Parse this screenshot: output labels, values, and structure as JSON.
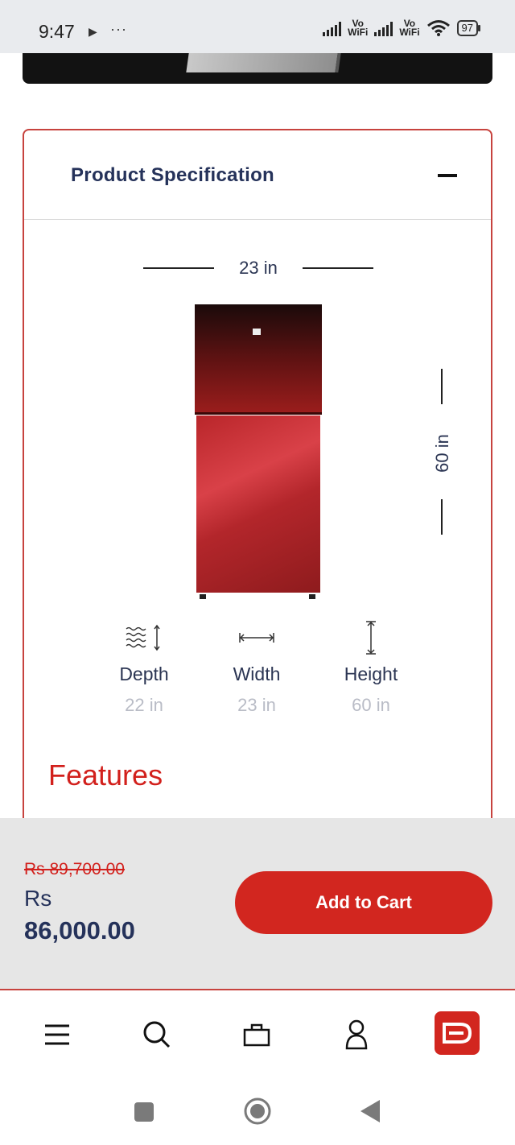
{
  "status_bar": {
    "time": "9:47",
    "play_icon": "play-icon",
    "dots": "···",
    "vowifi_1_top": "Vo",
    "vowifi_1_bottom": "WiFi",
    "vowifi_2_top": "Vo",
    "vowifi_2_bottom": "WiFi",
    "battery": "97"
  },
  "spec": {
    "title": "Product Specification",
    "collapse_icon": "minus-icon",
    "width_top": "23 in",
    "height_side": "60 in",
    "dimensions": [
      {
        "label": "Depth",
        "value": "22 in",
        "icon": "depth-icon"
      },
      {
        "label": "Width",
        "value": "23 in",
        "icon": "width-icon"
      },
      {
        "label": "Height",
        "value": "60 in",
        "icon": "height-icon"
      }
    ],
    "features_title": "Features"
  },
  "cart": {
    "old_price": "Rs 89,700.00",
    "price_currency": "Rs",
    "price_value": "86,000.00",
    "add_to_cart": "Add to Cart"
  },
  "bottom_nav": {
    "items": [
      "menu-icon",
      "search-icon",
      "bag-icon",
      "user-icon",
      "brand-logo-icon"
    ]
  },
  "system_nav": {
    "items": [
      "recents-icon",
      "home-icon",
      "back-icon"
    ]
  },
  "colors": {
    "accent_red": "#d2261f",
    "navy_text": "#25325a",
    "muted_text": "#b9bcc6"
  }
}
